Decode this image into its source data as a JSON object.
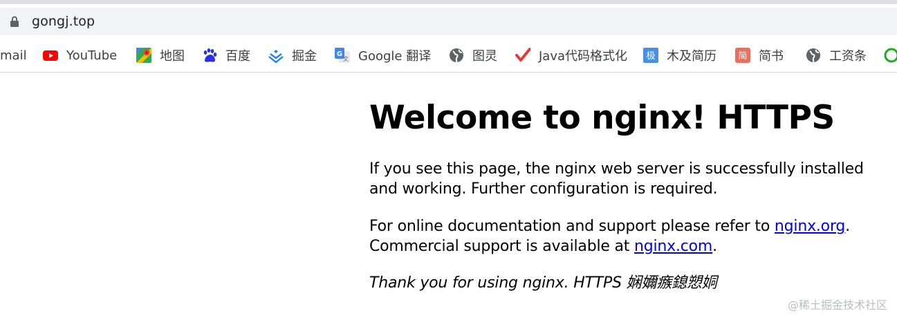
{
  "browser": {
    "url": "gongj.top",
    "bookmarks": [
      {
        "label": "mail",
        "icon": "gmail-icon"
      },
      {
        "label": "YouTube",
        "icon": "youtube-icon"
      },
      {
        "label": "地图",
        "icon": "maps-icon"
      },
      {
        "label": "百度",
        "icon": "baidu-icon"
      },
      {
        "label": "掘金",
        "icon": "juejin-icon"
      },
      {
        "label": "Google 翻译",
        "icon": "google-translate-icon"
      },
      {
        "label": "图灵",
        "icon": "globe-icon"
      },
      {
        "label": "Java代码格式化",
        "icon": "checkmark-icon"
      },
      {
        "label": "木及简历",
        "icon": "mujijianli-icon"
      },
      {
        "label": "简书",
        "icon": "jianshu-icon"
      },
      {
        "label": "工资条",
        "icon": "globe-icon"
      }
    ]
  },
  "page": {
    "title": "Welcome to nginx! HTTPS",
    "p1": "If you see this page, the nginx web server is successfully installed and working. Further configuration is required.",
    "p2_before": "For online documentation and support please refer to ",
    "p2_link1": "nginx.org",
    "p2_mid": ".",
    "p2_line2_before": "Commercial support is available at ",
    "p2_link2": "nginx.com",
    "p2_after": ".",
    "p3": "Thank you for using nginx. HTTPS 娴嬭瘯鎴愬姛"
  },
  "watermark": "@稀土掘金技术社区",
  "colors": {
    "link": "#0000ee",
    "omnibox": "#f1f3f4",
    "youtube": "#ff0000",
    "baidu": "#2932e1",
    "juejin": "#1e80ff",
    "jianshu": "#ea6f5a"
  }
}
